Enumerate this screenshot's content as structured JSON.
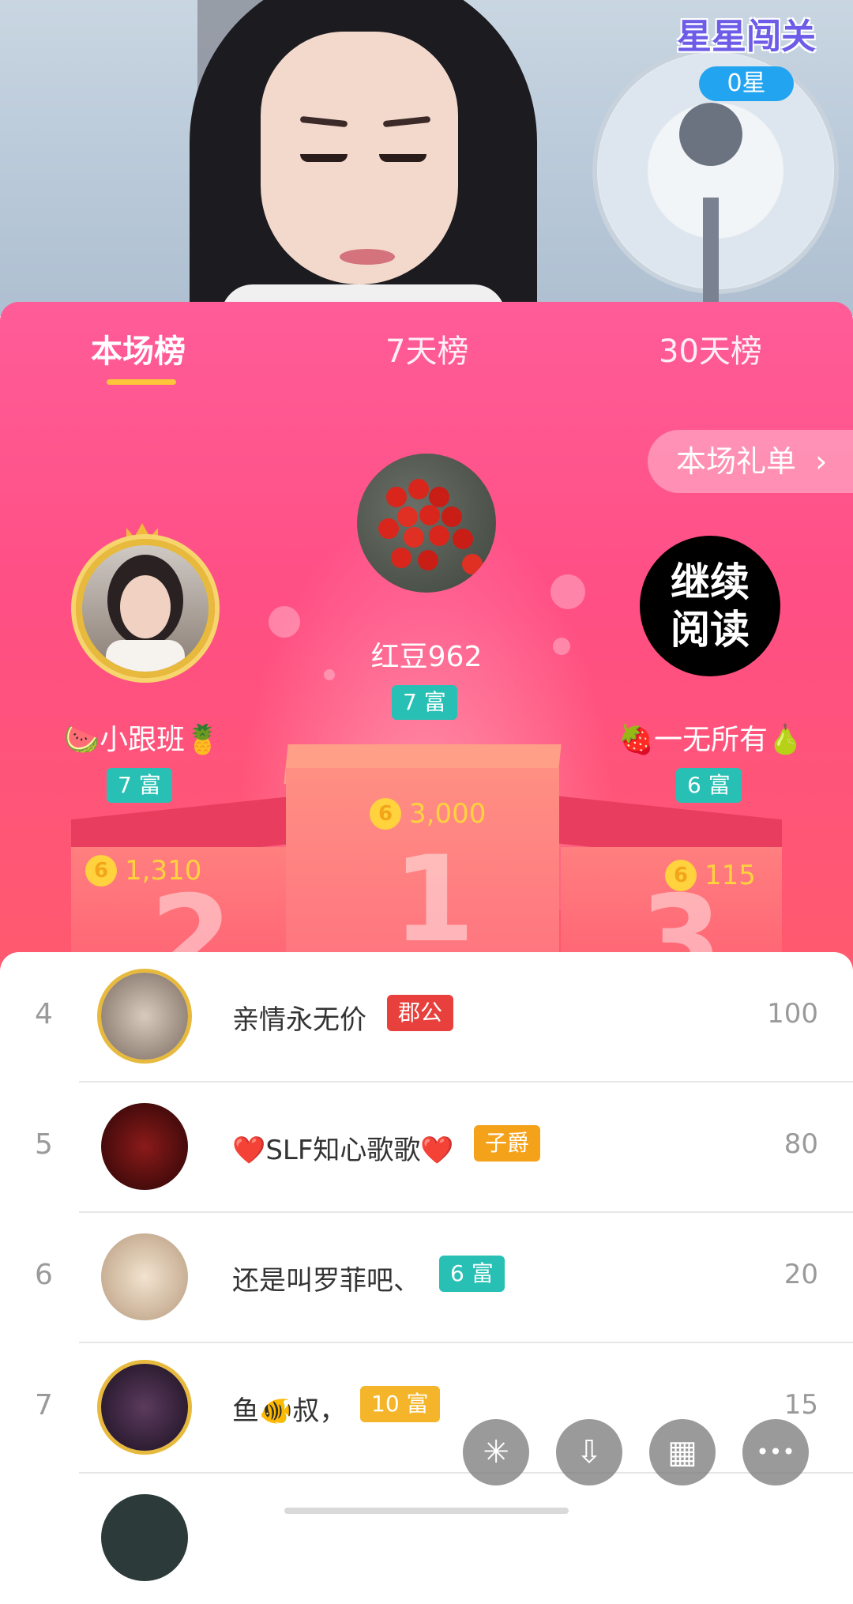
{
  "video": {
    "star_game": {
      "title": "星星闯关",
      "stars": "0星"
    }
  },
  "tabs": [
    {
      "label": "本场榜",
      "active": true
    },
    {
      "label": "7天榜",
      "active": false
    },
    {
      "label": "30天榜",
      "active": false
    }
  ],
  "gift_list_button": {
    "label": "本场礼单",
    "icon": "chevron-right-icon"
  },
  "top3": {
    "first": {
      "name": "红豆962",
      "level": "7 富",
      "coins": "3,000",
      "podium": "1"
    },
    "second": {
      "name": "🍉小跟班🍍",
      "level": "7 富",
      "coins": "1,310",
      "podium": "2"
    },
    "third": {
      "name": "🍓一无所有🍐",
      "level": "6 富",
      "coins": "115",
      "podium": "3",
      "avatar_text": "继续\n阅读"
    }
  },
  "coin_symbol": "6",
  "list": [
    {
      "rank": "4",
      "name": "亲情永无价",
      "badge": "郡公",
      "badge_color": "#e8403c",
      "score": "100"
    },
    {
      "rank": "5",
      "name": "❤️SLF知心歌歌❤️",
      "badge": "子爵",
      "badge_color": "#f5a21b",
      "score": "80"
    },
    {
      "rank": "6",
      "name": "还是叫罗菲吧、",
      "badge": "6 富",
      "badge_color": "#28c0b4",
      "score": "20"
    },
    {
      "rank": "7",
      "name": "鱼🐠叔，",
      "badge": "10 富",
      "badge_color": "#f5b52a",
      "score": "15"
    }
  ],
  "fab_buttons": [
    {
      "name": "share-icon",
      "glyph": "✳"
    },
    {
      "name": "download-icon",
      "glyph": "⇩"
    },
    {
      "name": "grid-icon",
      "glyph": "▦"
    },
    {
      "name": "more-icon",
      "glyph": "•••"
    }
  ],
  "colors": {
    "panel_pink": "#ff4f84",
    "coin_yellow": "#ffd23e",
    "tab_underline": "#ffc53a",
    "level_teal": "#28c0b4"
  }
}
